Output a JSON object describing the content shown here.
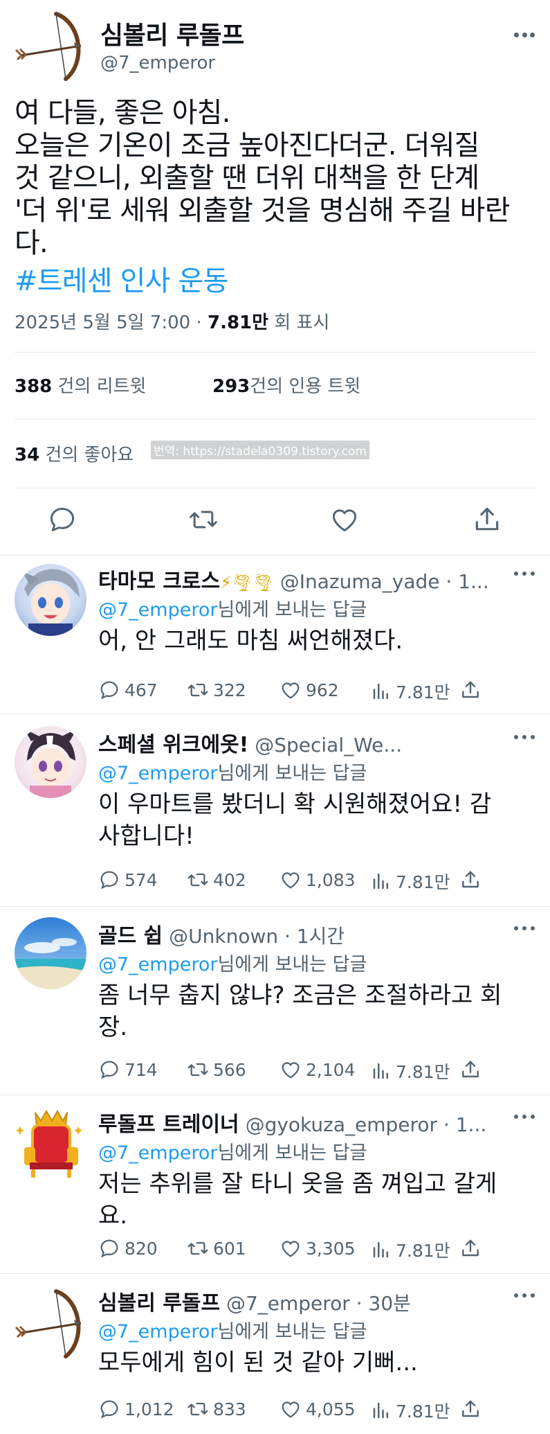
{
  "main": {
    "display_name": "심볼리 루돌프",
    "handle": "@7_emperor",
    "text_lines": [
      "여 다들, 좋은 아침.",
      "오늘은 기온이 조금 높아진다더군. 더워질",
      "것 같으니, 외출할 땐 더위 대책을 한 단계",
      "'더 위'로 세워 외출할 것을 명심해 주길 바란",
      "다."
    ],
    "hashtag": "#트레센 인사 운동",
    "date": "2025년 5월 5일  7:00 ·",
    "views": "7.81만",
    "views_label": "회 표시",
    "retweets_count": "388",
    "retweets_label": "건의 리트윗",
    "quotes_count": "293",
    "quotes_label": "건의 인용 트윗",
    "likes_count": "34",
    "likes_label": "건의 좋아요",
    "watermark": "번역: https://stadela0309.tistory.com"
  },
  "replies": [
    {
      "display_name": "타마모 크로스",
      "name_emoji": "⚡🌪🌪",
      "handle": "@Inazuma_yade · 1...",
      "to_handle": "@7_emperor",
      "to_suffix": "님에게 보내는 답글",
      "text_lines": [
        "어, 안 그래도 마침 써언해졌다."
      ],
      "replies": "467",
      "retweets": "322",
      "likes": "962",
      "views": "7.81만"
    },
    {
      "display_name": "스페셜 위크에옷!",
      "name_emoji": "",
      "handle": "@Special_We...",
      "to_handle": "@7_emperor",
      "to_suffix": "님에게 보내는 답글",
      "text_lines": [
        "이 우마트를 봤더니 확 시원해졌어요! 감",
        "사합니다!"
      ],
      "replies": "574",
      "retweets": "402",
      "likes": "1,083",
      "views": "7.81만"
    },
    {
      "display_name": "골드 쉽",
      "name_emoji": "",
      "handle": "@Unknown · 1시간",
      "to_handle": "@7_emperor",
      "to_suffix": "님에게 보내는 답글",
      "text_lines": [
        "좀 너무 춥지 않냐? 조금은 조절하라고 회",
        "장."
      ],
      "replies": "714",
      "retweets": "566",
      "likes": "2,104",
      "views": "7.81만"
    },
    {
      "display_name": "루돌프 트레이너",
      "name_emoji": "",
      "handle": "@gyokuza_emperor · 1...",
      "to_handle": "@7_emperor",
      "to_suffix": "님에게 보내는 답글",
      "text_lines": [
        "저는 추위를 잘 타니 옷을 좀 껴입고 갈게",
        "요."
      ],
      "replies": "820",
      "retweets": "601",
      "likes": "3,305",
      "views": "7.81만"
    },
    {
      "display_name": "심볼리 루돌프",
      "name_emoji": "",
      "handle": "@7_emperor · 30분",
      "to_handle": "@7_emperor",
      "to_suffix": "님에게 보내는 답글",
      "text_lines": [
        "모두에게 힘이 된 것 같아 기뻐..."
      ],
      "replies": "1,012",
      "retweets": "833",
      "likes": "4,055",
      "views": "7.81만"
    }
  ],
  "icons": {
    "reply": "reply-icon",
    "retweet": "retweet-icon",
    "like": "heart-icon",
    "share": "share-icon",
    "views": "views-icon",
    "more": "more-icon"
  },
  "colors": {
    "accent": "#1d9bf0",
    "muted": "#536471",
    "text": "#0f1419",
    "divider": "#e6e9ec"
  }
}
